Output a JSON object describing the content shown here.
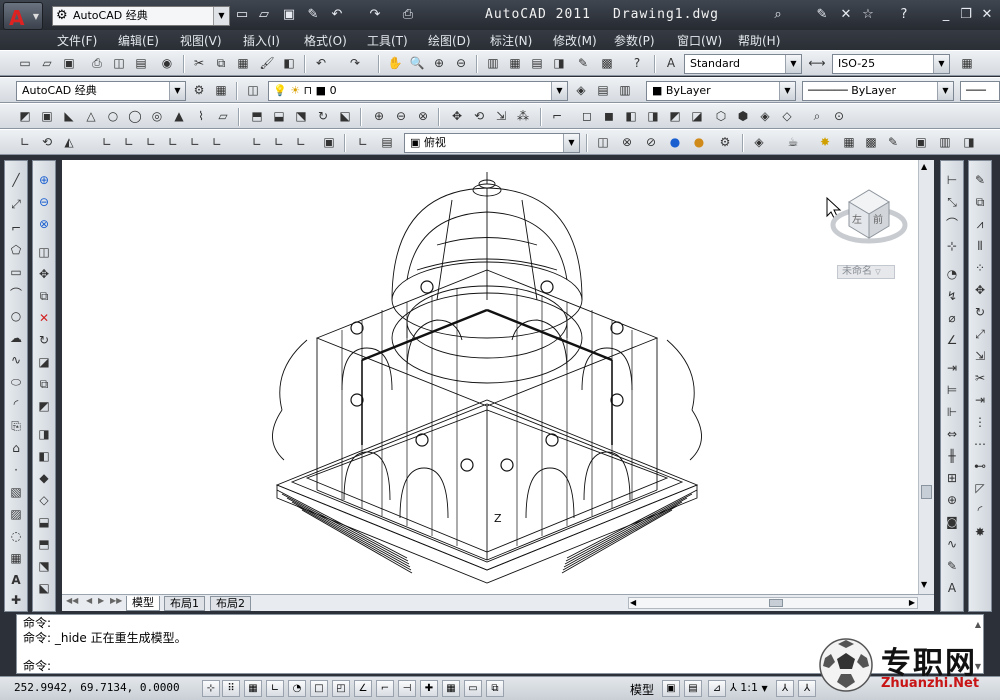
{
  "titlebar": {
    "app_title": "AutoCAD 2011",
    "document": "Drawing1.dwg",
    "workspace": "AutoCAD 经典"
  },
  "menu": [
    "文件(F)",
    "编辑(E)",
    "视图(V)",
    "插入(I)",
    "格式(O)",
    "工具(T)",
    "绘图(D)",
    "标注(N)",
    "修改(M)",
    "参数(P)",
    "窗口(W)",
    "帮助(H)"
  ],
  "toolbar": {
    "text_style": "Standard",
    "dim_style": "ISO-25",
    "workspace": "AutoCAD 经典",
    "layer": "0",
    "color": "ByLayer",
    "linetype": "ByLayer",
    "view": "俯视"
  },
  "viewcube": {
    "face_left": "左",
    "face_front": "前",
    "wcs_label": "未命名"
  },
  "tabs": [
    "模型",
    "布局1",
    "布局2"
  ],
  "command": {
    "line1": "命令:",
    "line2": "命令: _hide 正在重生成模型。",
    "line3": "命令:"
  },
  "status": {
    "coords": "252.9942, 69.7134, 0.0000",
    "model": "模型",
    "scale": "1:1"
  },
  "watermark": {
    "brand": "专职网",
    "url": "Zhuanzhi.Net"
  },
  "colors": {
    "accent": "#d22222",
    "canvas": "#ffffff",
    "chrome_dark": "#2c3038",
    "watermark_red": "#c81414"
  }
}
